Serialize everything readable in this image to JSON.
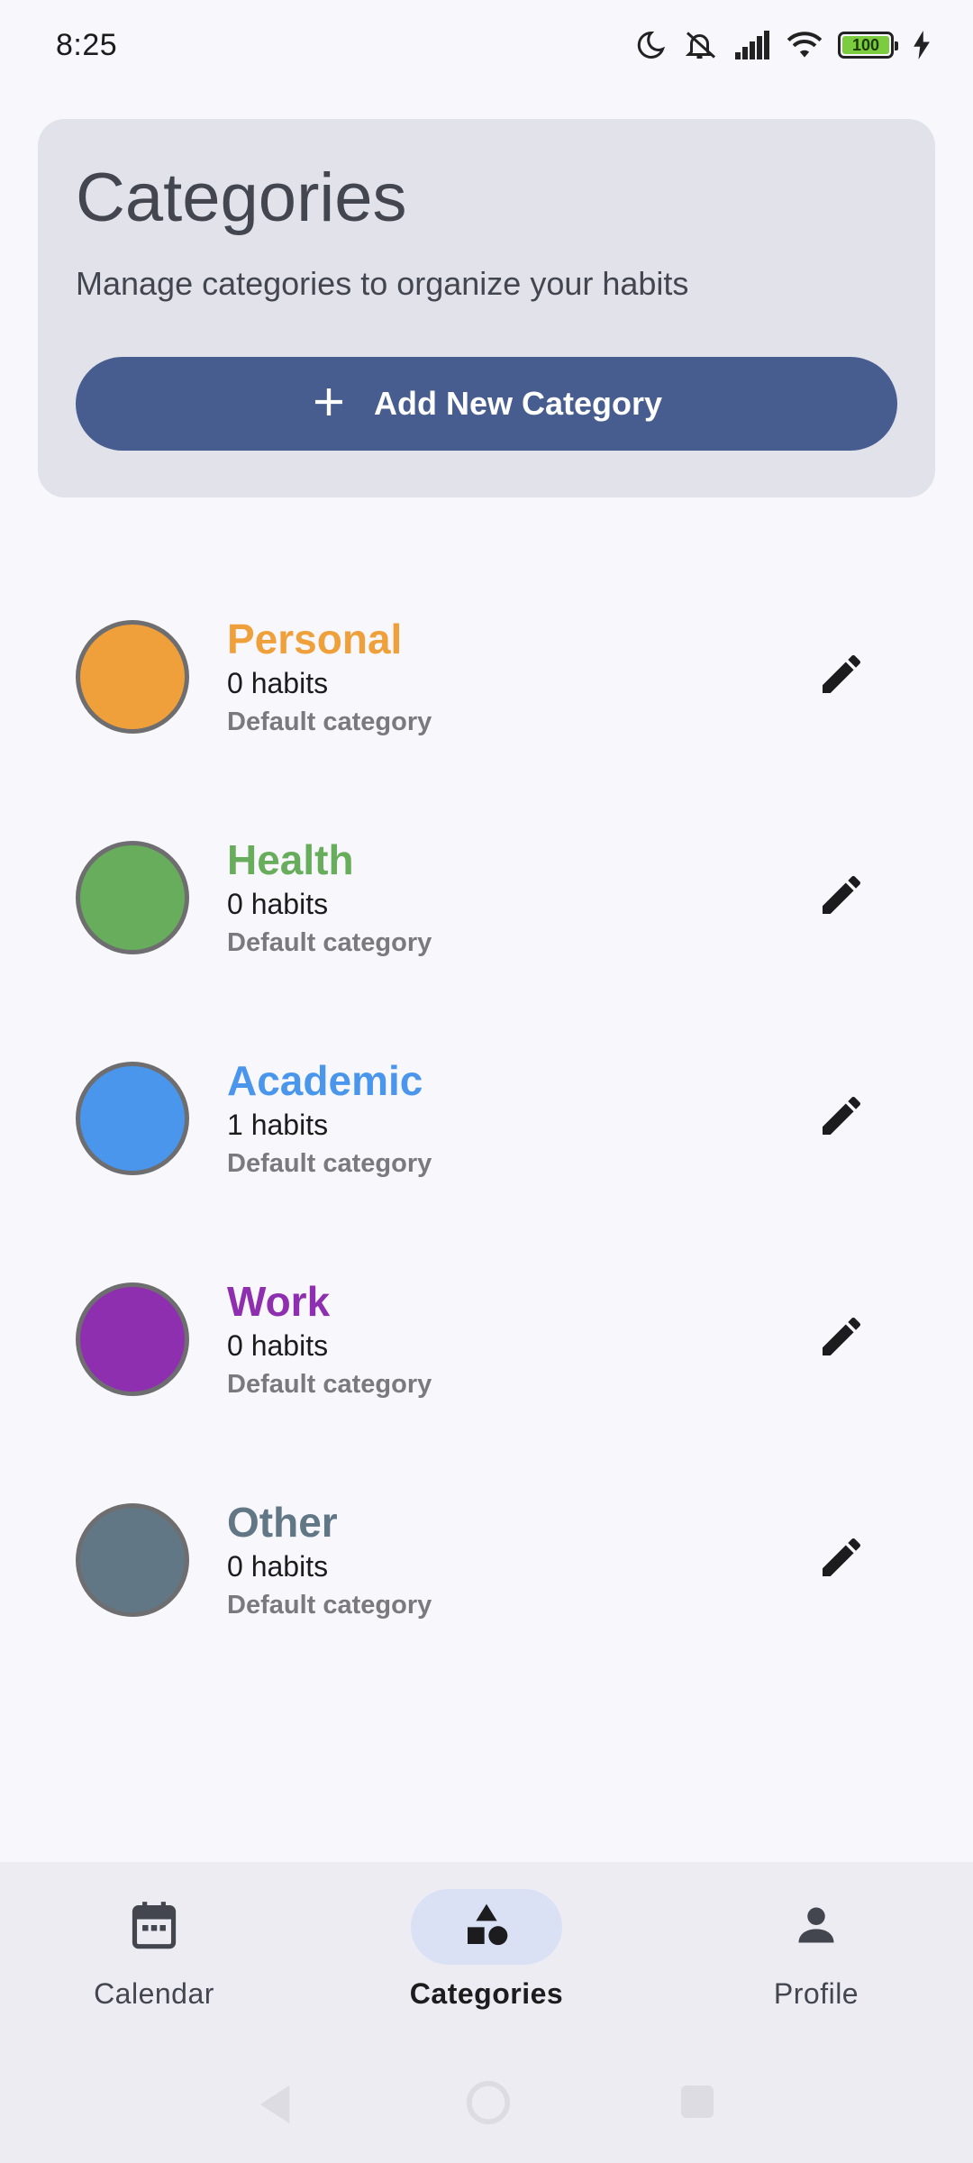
{
  "status_bar": {
    "time": "8:25",
    "battery_level": "100",
    "icons": [
      "moon-icon",
      "silent-icon",
      "signal-icon",
      "wifi-icon",
      "battery-icon",
      "charging-icon"
    ]
  },
  "header": {
    "title": "Categories",
    "subtitle": "Manage categories to organize your habits",
    "add_button_label": "Add New Category",
    "add_button_icon": "plus-icon"
  },
  "categories": [
    {
      "name": "Personal",
      "count": "0 habits",
      "description": "Default category",
      "color": "#f0a03b"
    },
    {
      "name": "Health",
      "count": "0 habits",
      "description": "Default category",
      "color": "#67ad5b"
    },
    {
      "name": "Academic",
      "count": "1 habits",
      "description": "Default category",
      "color": "#4a96ec"
    },
    {
      "name": "Work",
      "count": "0 habits",
      "description": "Default category",
      "color": "#8e2fb0"
    },
    {
      "name": "Other",
      "count": "0 habits",
      "description": "Default category",
      "color": "#627785"
    }
  ],
  "bottom_nav": {
    "items": [
      {
        "label": "Calendar",
        "icon": "calendar-icon",
        "active": false
      },
      {
        "label": "Categories",
        "icon": "shapes-icon",
        "active": true
      },
      {
        "label": "Profile",
        "icon": "person-icon",
        "active": false
      }
    ]
  },
  "colors": {
    "background": "#f8f8fc",
    "header_card": "#e1e2ea",
    "primary_button": "#475d8f",
    "nav_background": "#ececf2",
    "nav_active_pill": "#dbe1f5"
  }
}
